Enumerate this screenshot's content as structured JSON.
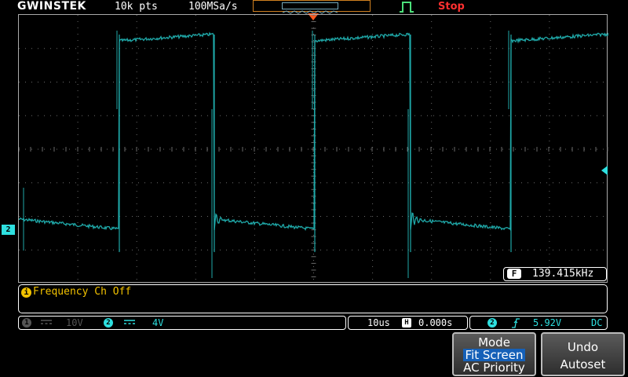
{
  "topbar": {
    "brand": "GWINSTEK",
    "record_length": "10k pts",
    "sample_rate": "100MSa/s",
    "run_state": "Stop"
  },
  "colors": {
    "trace": "#1fa8a8",
    "channel2": "#2ee0e0",
    "trigger_marker": "#ff5a1e",
    "message": "#f2c200",
    "stop": "#ff3030",
    "softkey_highlight": "#1560b8"
  },
  "icons": {
    "trigger_pos": "triangle-down",
    "trigger_level": "triangle-left",
    "edge_type": "pulse-icon",
    "rising_edge": "rising-edge-icon"
  },
  "waveform": {
    "channel_marker": "2",
    "frequency_tag": "F",
    "frequency": "139.415kHz"
  },
  "message": {
    "icon": "i",
    "text": "Frequency Ch Off"
  },
  "status": {
    "ch1_number": "1",
    "ch1_scale": "10V",
    "ch2_number": "2",
    "ch2_scale": "4V",
    "timebase": "10us",
    "horizontal_tag": "H",
    "horizontal_position": "0.000s",
    "trigger_source": "2",
    "trigger_level": "5.92V",
    "trigger_coupling": "DC"
  },
  "softkeys": {
    "mode": {
      "title": "Mode",
      "option_selected": "Fit Screen",
      "option_other": "AC Priority"
    },
    "undo": {
      "line1": "Undo",
      "line2": "Autoset"
    }
  }
}
